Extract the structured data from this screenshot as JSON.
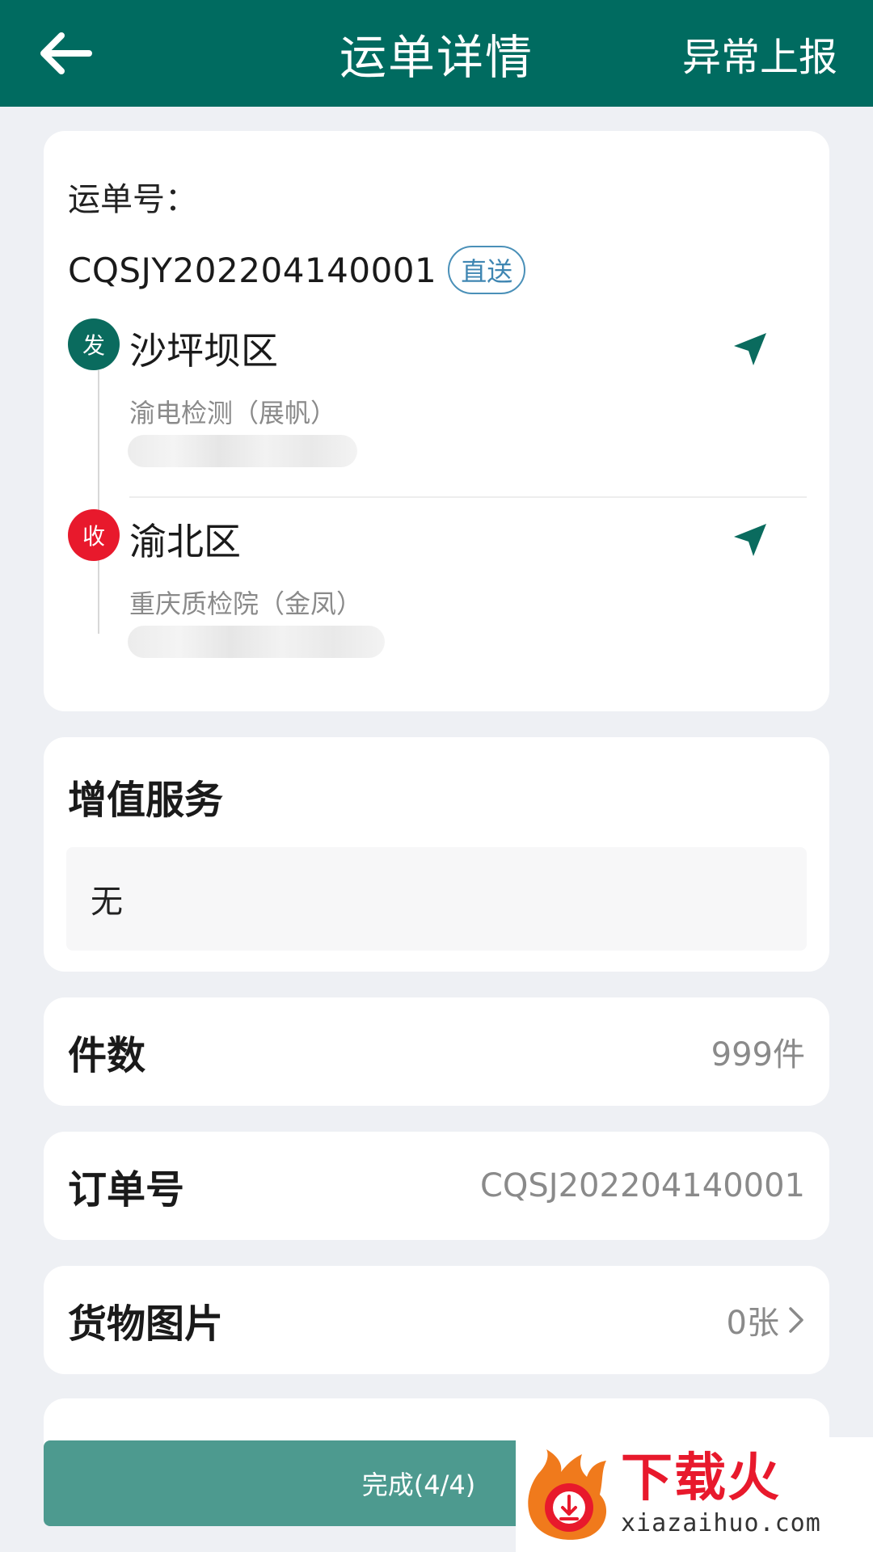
{
  "header": {
    "title": "运单详情",
    "report_label": "异常上报"
  },
  "waybill": {
    "label": "运单号：",
    "number": "CQSJY202204140001",
    "tag": "直送",
    "sender": {
      "badge": "发",
      "district": "沙坪坝区",
      "company": "渝电检测（展帆）"
    },
    "receiver": {
      "badge": "收",
      "district": "渝北区",
      "company": "重庆质检院（金凤）"
    }
  },
  "service": {
    "title": "增值服务",
    "value": "无"
  },
  "pieces": {
    "label": "件数",
    "value": "999件"
  },
  "order": {
    "label": "订单号",
    "value": "CQSJ202204140001"
  },
  "photos": {
    "label": "货物图片",
    "value": "0张"
  },
  "footer": {
    "complete_label": "完成(4/4)"
  },
  "watermark": {
    "text": "下载火",
    "url": "xiazaihuo.com"
  },
  "colors": {
    "primary": "#006b60",
    "send_badge": "#0a6b5e",
    "receive_badge": "#e8192c",
    "tag_blue": "#3f86b2",
    "button": "#4d9a8f"
  }
}
